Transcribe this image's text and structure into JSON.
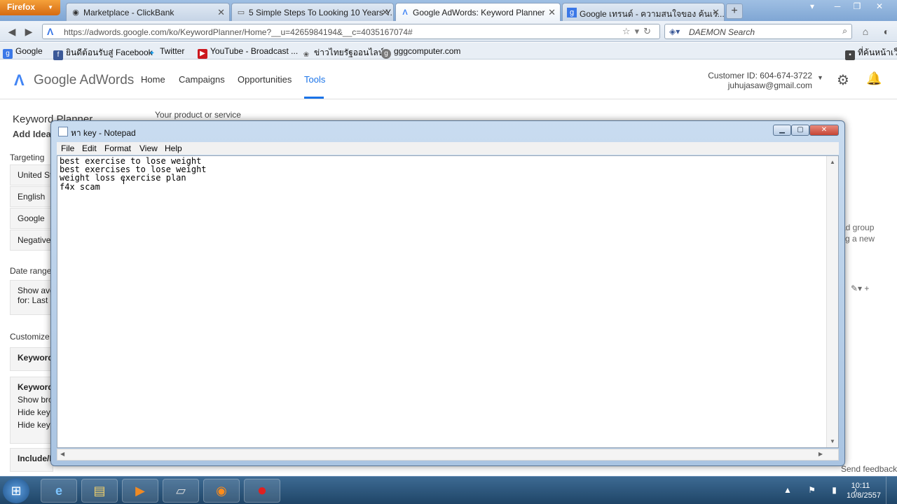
{
  "browser": {
    "app_button": "Firefox",
    "tabs": [
      {
        "label": "Marketplace - ClickBank",
        "icon": "clickbank-icon"
      },
      {
        "label": "5 Simple Steps To Looking 10 Years Y...",
        "icon": "page-icon"
      },
      {
        "label": "Google AdWords: Keyword Planner",
        "icon": "adwords-icon",
        "active": true
      },
      {
        "label": "Google เทรนด์ - ความสนใจของ ค้นเว...",
        "icon": "google-icon"
      }
    ],
    "url": "https://adwords.google.com/ko/KeywordPlanner/Home?__u=4265984194&__c=4035167074#",
    "search_placeholder": "DAEMON Search",
    "bookmarks": [
      "Google",
      "ยินดีต้อนรับสู่ Facebook",
      "Twitter",
      "YouTube - Broadcast ...",
      "ข่าวไทยรัฐออนไลน์",
      "gggcomputer.com"
    ],
    "bookmarks_right": "ที่ค้นหน้าเว็บ"
  },
  "adwords": {
    "logo_google": "Google",
    "logo_product": "AdWords",
    "nav": [
      "Home",
      "Campaigns",
      "Opportunities",
      "Tools"
    ],
    "customer_id": "Customer ID: 604-674-3722",
    "email": "juhujasaw@gmail.com",
    "page_title": "Keyword Planner",
    "add_ideas": "Add Idea",
    "product_label": "Your product or service",
    "left_panel": {
      "targeting": "Targeting",
      "country": "United St",
      "language": "English",
      "network": "Google",
      "negative": "Negative",
      "date_range": "Date range",
      "show_avg": "Show avg",
      "for_last": "for: Last",
      "customize": "Customize",
      "keyword_filters": "Keyword",
      "keyword_options": "Keyword",
      "show_broad": "Show bro",
      "hide_1": "Hide key",
      "hide_2": "Hide key",
      "include": "Include/E"
    },
    "right_panel": {
      "ad_group": "ad group",
      "new": "g a new",
      "send_feedback": "Send feedback"
    }
  },
  "notepad": {
    "title": "หา key - Notepad",
    "menu": [
      "File",
      "Edit",
      "Format",
      "View",
      "Help"
    ],
    "content": "best exercise to lose weight\nbest exercises to lose weight\nweight loss exercise plan\nf4x scam"
  },
  "taskbar": {
    "time": "10:11",
    "date": "10/8/2557"
  }
}
